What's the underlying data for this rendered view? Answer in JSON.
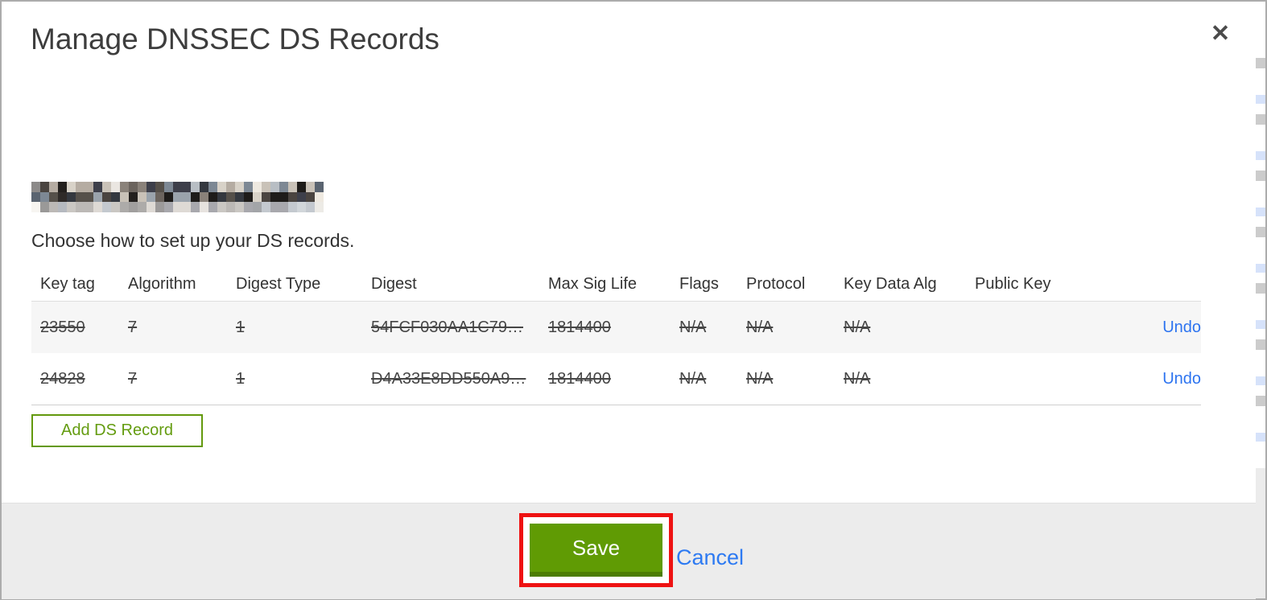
{
  "modal": {
    "title": "Manage DNSSEC DS Records",
    "close_glyph": "✕",
    "domain_redacted": true,
    "subtitle": "Choose how to set up your DS records.",
    "table": {
      "columns": [
        "Key tag",
        "Algorithm",
        "Digest Type",
        "Digest",
        "Max Sig Life",
        "Flags",
        "Protocol",
        "Key Data Alg",
        "Public Key"
      ],
      "rows": [
        {
          "cells": [
            "23550",
            "7",
            "1",
            "54FCF030AA1C79…",
            "1814400",
            "N/A",
            "N/A",
            "N/A",
            ""
          ],
          "action": "Undo",
          "deleted": true
        },
        {
          "cells": [
            "24828",
            "7",
            "1",
            "D4A33E8DD550A9…",
            "1814400",
            "N/A",
            "N/A",
            "N/A",
            ""
          ],
          "action": "Undo",
          "deleted": true
        }
      ]
    },
    "add_button_label": "Add DS Record",
    "footer": {
      "save_label": "Save",
      "cancel_label": "Cancel"
    }
  },
  "colors": {
    "link_blue": "#2d74f0",
    "save_green": "#609b04",
    "save_green_dark": "#4d7d03",
    "add_button_green": "#63990d",
    "annotation_red": "#ee1212",
    "footer_gray": "#ececec",
    "row_stripe_gray": "#f6f6f6",
    "text_dark": "#3d3d3d"
  },
  "redacted_domain": {
    "cols": 33,
    "rows": 3,
    "palette": [
      "#2e2a28",
      "#4a4440",
      "#6b645e",
      "#8a827a",
      "#b5aca2",
      "#d8d2c8",
      "#3d3f4a",
      "#5a6470",
      "#7d8894",
      "#23201e",
      "#c9c2b8",
      "#55504a",
      "#34383f",
      "#9aa3ac",
      "#eee9e0",
      "#1e1c1a"
    ]
  }
}
